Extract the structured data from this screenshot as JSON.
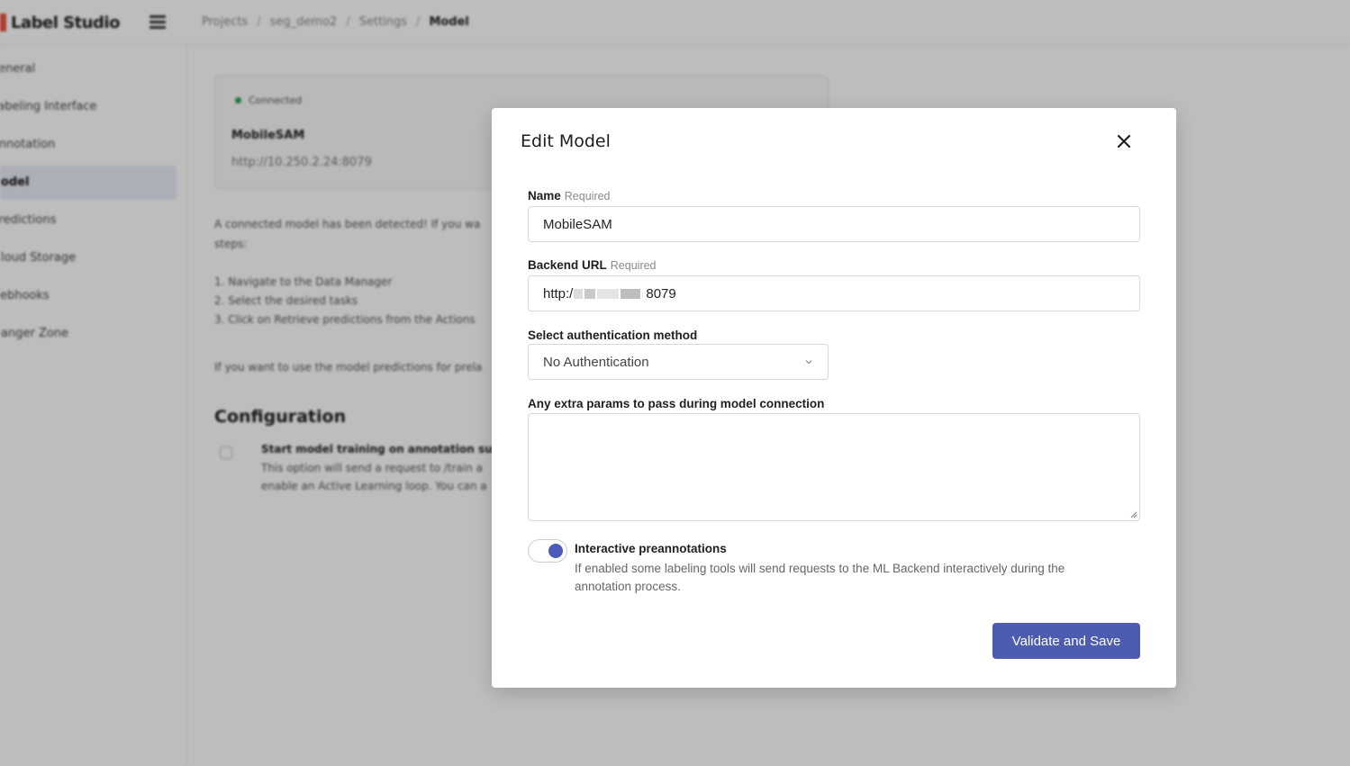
{
  "app": {
    "logo_text": "Label Studio"
  },
  "breadcrumb": [
    "Projects",
    "seg_demo2",
    "Settings",
    "Model"
  ],
  "sidebar": {
    "items": [
      {
        "label": "General"
      },
      {
        "label": "Labeling Interface"
      },
      {
        "label": "Annotation"
      },
      {
        "label": "Model"
      },
      {
        "label": "Predictions"
      },
      {
        "label": "Cloud Storage"
      },
      {
        "label": "Webhooks"
      },
      {
        "label": "Danger Zone"
      }
    ]
  },
  "model_card": {
    "status": "Connected",
    "name": "MobileSAM",
    "url": "http://10.250.2.24:8079"
  },
  "background_text": {
    "detected_line1": "A connected model has been detected! If you wa",
    "detected_line2": "steps:",
    "step1": "1. Navigate to the Data Manager",
    "step2": "2. Select the desired tasks",
    "step3": "3. Click on Retrieve predictions from the Actions",
    "predictions_hint": "If you want to use the model predictions for prela",
    "config_heading": "Configuration",
    "config_option_title": "Start model training on annotation subm",
    "config_option_desc1": "This option will send a request to /train a",
    "config_option_desc2": "enable an Active Learning loop. You can a"
  },
  "modal": {
    "title": "Edit Model",
    "name_label": "Name",
    "name_required": "Required",
    "name_value": "MobileSAM",
    "url_label": "Backend URL",
    "url_required": "Required",
    "url_prefix": "http:/",
    "url_suffix": "8079",
    "auth_label": "Select authentication method",
    "auth_value": "No Authentication",
    "params_label": "Any extra params to pass during model connection",
    "params_value": "",
    "toggle_title": "Interactive preannotations",
    "toggle_desc": "If enabled some labeling tools will send requests to the ML Backend interactively during the annotation process.",
    "toggle_on": true,
    "save_label": "Validate and Save"
  },
  "colors": {
    "accent": "#4c5cb0",
    "connected": "#2e9e5b",
    "logo_red": "#e8533f"
  }
}
